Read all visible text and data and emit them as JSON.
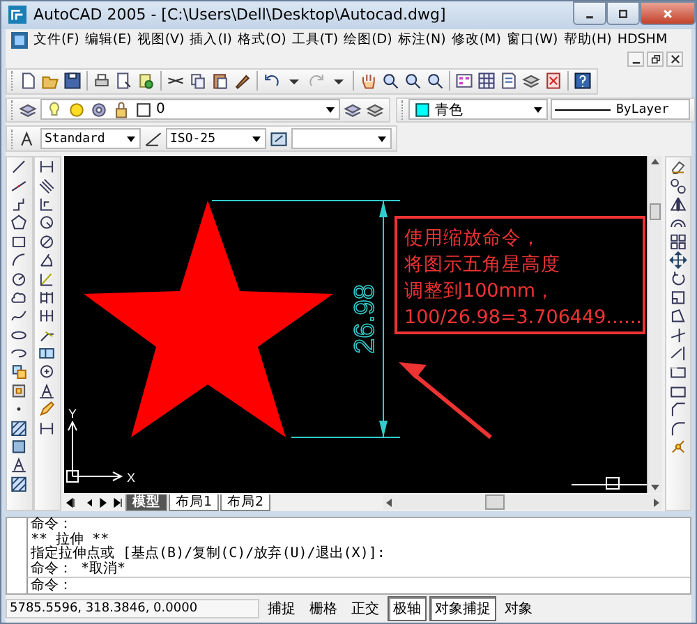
{
  "window": {
    "title": "AutoCAD 2005 - [C:\\Users\\Dell\\Desktop\\Autocad.dwg]"
  },
  "menu": [
    "文件(F)",
    "编辑(E)",
    "视图(V)",
    "插入(I)",
    "格式(O)",
    "工具(T)",
    "绘图(D)",
    "标注(N)",
    "修改(M)",
    "窗口(W)",
    "帮助(H)",
    "HDSHM"
  ],
  "layers_toolbar": {
    "layer": "0",
    "color_name": "青色",
    "linetype": "ByLayer"
  },
  "styles_toolbar": {
    "text_style": "Standard",
    "dim_style": "ISO-25"
  },
  "drawing": {
    "dimension": "26.98",
    "axis_x": "X",
    "axis_y": "Y",
    "note_lines": [
      "使用缩放命令，",
      "将图示五角星高度",
      "调整到100mm，",
      "100/26.98=3.706449......"
    ]
  },
  "layout_tabs": [
    {
      "label": "模型",
      "selected": true
    },
    {
      "label": "布局1",
      "selected": false
    },
    {
      "label": "布局2",
      "selected": false
    }
  ],
  "command_history": [
    "命令：",
    "** 拉伸 **",
    "指定拉伸点或 [基点(B)/复制(C)/放弃(U)/退出(X)]:",
    "命令： *取消*"
  ],
  "command_prompt": "命令：",
  "status_bar": {
    "coordinates": "5785.5596, 318.3846, 0.0000",
    "buttons": [
      {
        "label": "捕捉",
        "on": false
      },
      {
        "label": "栅格",
        "on": false
      },
      {
        "label": "正交",
        "on": false
      },
      {
        "label": "极轴",
        "on": true
      },
      {
        "label": "对象捕捉",
        "on": true
      },
      {
        "label": "对象",
        "on": false
      }
    ]
  }
}
